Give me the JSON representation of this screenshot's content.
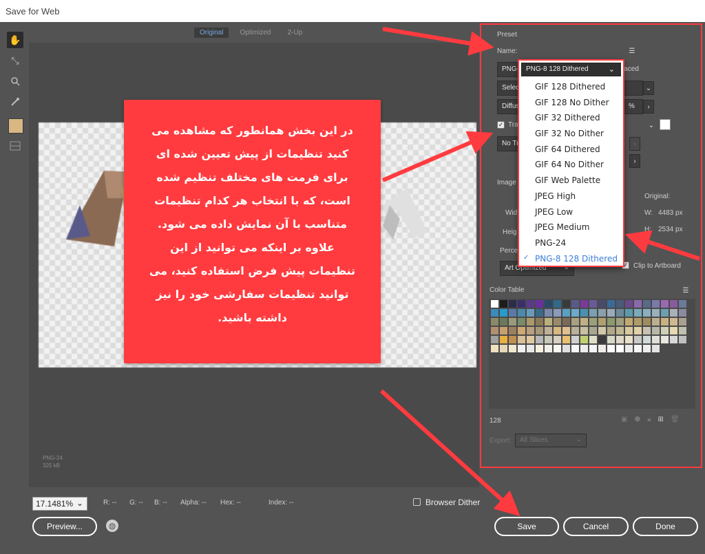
{
  "window": {
    "title": "Save for Web"
  },
  "tools": [
    {
      "name": "hand-tool-icon",
      "glyph": "✋",
      "active": true
    },
    {
      "name": "slice-select-tool-icon",
      "glyph": "⇲"
    },
    {
      "name": "zoom-tool-icon",
      "glyph": "⌕"
    },
    {
      "name": "eyedropper-tool-icon",
      "glyph": "✎"
    }
  ],
  "view_tabs": [
    "Original",
    "Optimized",
    "2-Up"
  ],
  "canvas_info": [
    "PNG-24",
    "325 kB"
  ],
  "callout": {
    "text": "در این بخش همانطور که مشاهده می\nکنید تنظیمات از پیش تعیین شده ای\nبرای فرمت های مختلف تنظیم شده\nاست، که با انتخاب هر کدام تنظیمات\nمتناسب با آن نمایش داده می شود.\nعلاوه بر اینکه می توانید از این\nتنظیمات پیش فرض استفاده کنید، می\nتوانید تنظیمات سفارشی خود را نیز\nداشته باشید."
  },
  "panel": {
    "preset_label": "Preset",
    "name_label": "Name:",
    "format_value": "PNG-8",
    "interlaced_fragment": "laced",
    "reduction_fragment": "Select",
    "dither_fragment": "Diffus",
    "percent_fragment": "%",
    "transparency_fragment": "Tra",
    "no_transparency_fragment": "No Tr",
    "image_size_label": "Image",
    "original_label": "Original:",
    "width_fragment": "Widt",
    "height_fragment": "Heig",
    "orig_w_label": "W:",
    "orig_w": "4483 px",
    "orig_h_label": "H:",
    "orig_h": "2534 px",
    "percent_label": "Percent:",
    "percent_value": "100",
    "quality_value": "Art Optimized",
    "clip_label": "Clip to Artboard",
    "color_table_label": "Color Table",
    "color_count": "128",
    "export_label": "Export:",
    "export_value": "All Slices"
  },
  "preset_dropdown": {
    "selected": "PNG-8 128 Dithered",
    "options": [
      "GIF 128 Dithered",
      "GIF 128 No Dither",
      "GIF 32 Dithered",
      "GIF 32 No Dither",
      "GIF 64 Dithered",
      "GIF 64 No Dither",
      "GIF Web Palette",
      "JPEG High",
      "JPEG Low",
      "JPEG Medium",
      "PNG-24",
      "PNG-8 128 Dithered"
    ]
  },
  "color_table_colors": [
    "#ffffff",
    "#1c1c1c",
    "#2b2b4a",
    "#3a2f6a",
    "#5a3a8a",
    "#6a2fa0",
    "#2a4a6a",
    "#2f6a8a",
    "#3a3a3a",
    "#5a5a8a",
    "#7a3a9a",
    "#6a5a9a",
    "#4a4a6a",
    "#3a6a9a",
    "#4a5a7a",
    "#6a4a8a",
    "#8a6aaa",
    "#5a6a8a",
    "#7a7aaa",
    "#9a6ab0",
    "#8a5aa0",
    "#6a7a9a",
    "#3a8aba",
    "#2a9aca",
    "#5a7aaa",
    "#4a8aaa",
    "#6a9aba",
    "#3a6a8a",
    "#7a8aaa",
    "#8a9aba",
    "#5aa0c0",
    "#6aaaca",
    "#4a90b0",
    "#7aa0b0",
    "#8aa0aa",
    "#9aaaba",
    "#6a8a9a",
    "#5a9aaa",
    "#7aaaba",
    "#8ab0c0",
    "#9ab0ba",
    "#6aa0b0",
    "#aab0b8",
    "#8a8aa0",
    "#8a8a6a",
    "#6a7a5a",
    "#9a9a7a",
    "#7a8a6a",
    "#aa9a6a",
    "#8a7a5a",
    "#bab07a",
    "#9a8a6a",
    "#7a6a5a",
    "#aaa080",
    "#c0b088",
    "#9aa07a",
    "#b0a070",
    "#8a9a6a",
    "#a0a080",
    "#c0a870",
    "#b09a6a",
    "#a08a60",
    "#bab090",
    "#c8b080",
    "#d0b890",
    "#aaa090",
    "#b09070",
    "#c8a070",
    "#9a8060",
    "#d0a870",
    "#b8a080",
    "#a89878",
    "#c0b098",
    "#d8b880",
    "#e0c090",
    "#b8b098",
    "#c8c0a0",
    "#a8a890",
    "#d0c8a8",
    "#b0a888",
    "#c0b890",
    "#d8c8a0",
    "#e0d0a8",
    "#c8c0b0",
    "#b8b8a8",
    "#d0d0b8",
    "#e8d8b0",
    "#c0c0b0",
    "#a0a0a0",
    "#e8b040",
    "#c09050",
    "#d8c098",
    "#e0c8a0",
    "#b8b8b8",
    "#c8c8b8",
    "#d8d0c0",
    "#e8c070",
    "#d0d0d0",
    "#c0d070",
    "#e0e0c8",
    "#3a3a3a",
    "#d8d8c8",
    "#e0d8c8",
    "#e8e0c8",
    "#c8c8c8",
    "#d0d8d8",
    "#e0e0d8",
    "#e8e8e0",
    "#d8d8d8",
    "#c0c0c0",
    "#f0e0c0",
    "#e8d8b8",
    "#f0e8d0",
    "#f0f0f0",
    "#e8e8e8",
    "#f8f0e0",
    "#f0f0e8",
    "#f8f8f0",
    "#e0e0e0",
    "#f8f8f8",
    "#ececec",
    "#f4f4f4",
    "#f0ece8",
    "#fafafa",
    "#ffffff",
    "#ebebeb",
    "#f6f6f6",
    "#eeeeee",
    "#e4e4e4"
  ],
  "bottom": {
    "zoom": "17.1481%",
    "r": "R: --",
    "g": "G: --",
    "b": "B: --",
    "alpha": "Alpha: --",
    "hex": "Hex: --",
    "index": "Index: --",
    "browser_dither": "Browser Dither",
    "preview": "Preview...",
    "save": "Save",
    "cancel": "Cancel",
    "done": "Done"
  }
}
